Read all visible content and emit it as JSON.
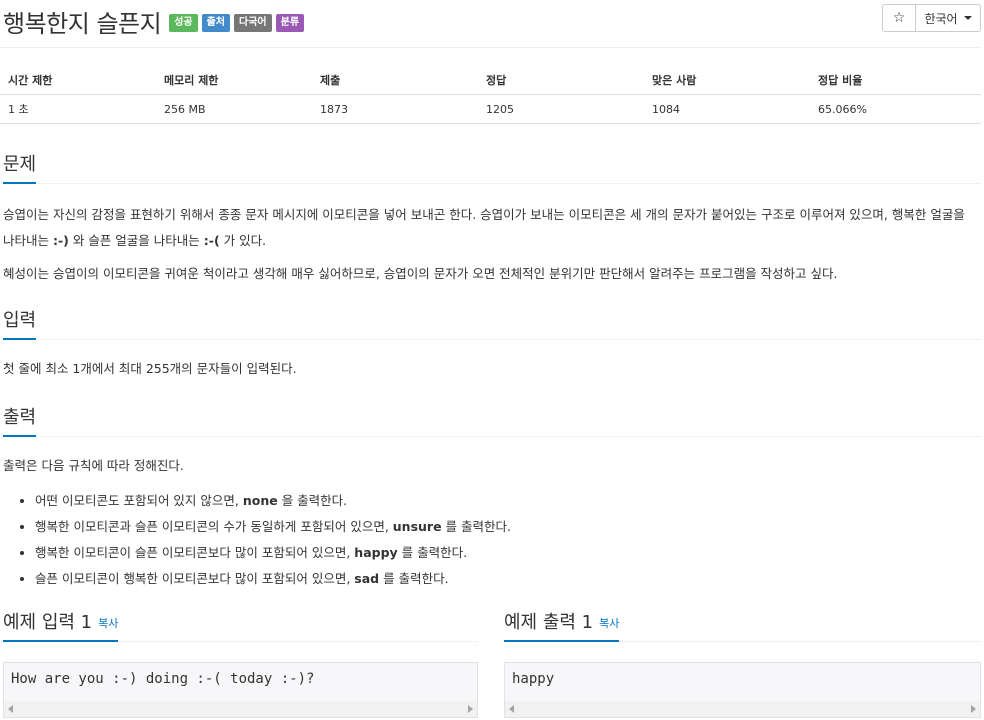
{
  "problem": {
    "title": "행복한지 슬픈지",
    "badges": [
      {
        "label": "성공",
        "color": "#5cb85c"
      },
      {
        "label": "출처",
        "color": "#428bca"
      },
      {
        "label": "다국어",
        "color": "#777777"
      },
      {
        "label": "분류",
        "color": "#9b59b6"
      }
    ]
  },
  "actions": {
    "star_icon": "☆",
    "language": "한국어"
  },
  "info_table": {
    "headers": [
      "시간 제한",
      "메모리 제한",
      "제출",
      "정답",
      "맞은 사람",
      "정답 비율"
    ],
    "values": [
      "1 초",
      "256 MB",
      "1873",
      "1205",
      "1084",
      "65.066%"
    ]
  },
  "sections": {
    "description": {
      "heading": "문제",
      "p1_a": "승엽이는 자신의 감정을 표현하기 위해서 종종 문자 메시지에 이모티콘을 넣어 보내곤 한다. 승엽이가 보내는 이모티콘은 세 개의 문자가 붙어있는 구조로 이루어져 있으며, 행복한 얼굴을 나타내는 ",
      "p1_happy": ":-)",
      "p1_b": " 와 슬픈 얼굴을 나타내는 ",
      "p1_sad": ":-(",
      "p1_c": " 가 있다.",
      "p2": "혜성이는 승엽이의 이모티콘을 귀여운 척이라고 생각해 매우 싫어하므로, 승엽이의 문자가 오면 전체적인 분위기만 판단해서 알려주는 프로그램을 작성하고 싶다."
    },
    "input": {
      "heading": "입력",
      "text": "첫 줄에 최소 1개에서 최대 255개의 문자들이 입력된다."
    },
    "output": {
      "heading": "출력",
      "text": "출력은 다음 규칙에 따라 정해진다.",
      "rules": [
        {
          "pre": "어떤 이모티콘도 포함되어 있지 않으면, ",
          "bold": "none",
          "post": " 을 출력한다."
        },
        {
          "pre": "행복한 이모티콘과 슬픈 이모티콘의 수가 동일하게 포함되어 있으면, ",
          "bold": "unsure",
          "post": " 를 출력한다."
        },
        {
          "pre": "행복한 이모티콘이 슬픈 이모티콘보다 많이 포함되어 있으면, ",
          "bold": "happy",
          "post": " 를 출력한다."
        },
        {
          "pre": "슬픈 이모티콘이 행복한 이모티콘보다 많이 포함되어 있으면, ",
          "bold": "sad",
          "post": " 를 출력한다."
        }
      ]
    }
  },
  "samples": {
    "input": {
      "heading": "예제 입력 1",
      "copy": "복사",
      "content": "How are you :-) doing :-( today :-)?"
    },
    "output": {
      "heading": "예제 출력 1",
      "copy": "복사",
      "content": "happy"
    }
  }
}
